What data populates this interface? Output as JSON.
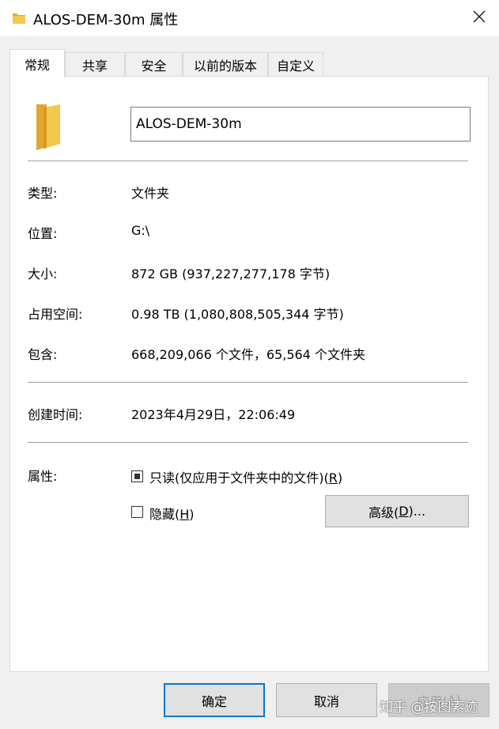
{
  "window": {
    "title": "ALOS-DEM-30m 属性",
    "close_icon": "close-icon"
  },
  "tabs": [
    {
      "label": "常规",
      "active": true
    },
    {
      "label": "共享",
      "active": false
    },
    {
      "label": "安全",
      "active": false
    },
    {
      "label": "以前的版本",
      "active": false
    },
    {
      "label": "自定义",
      "active": false
    }
  ],
  "general": {
    "folder_icon": "folder-icon",
    "name_value": "ALOS-DEM-30m",
    "type_label": "类型:",
    "type_value": "文件夹",
    "location_label": "位置:",
    "location_value": "G:\\",
    "size_label": "大小:",
    "size_value": "872 GB (937,227,277,178 字节)",
    "disk_size_label": "占用空间:",
    "disk_size_value": "0.98 TB (1,080,808,505,344 字节)",
    "contains_label": "包含:",
    "contains_value": "668,209,066 个文件，65,564 个文件夹",
    "created_label": "创建时间:",
    "created_value": "2023年4月29日，22:06:49",
    "attributes_label": "属性:",
    "readonly_text": "只读(仅应用于文件夹中的文件)(",
    "readonly_key": "R",
    "readonly_close": ")",
    "readonly_state": "indeterminate",
    "hidden_text": "隐藏(",
    "hidden_key": "H",
    "hidden_close": ")",
    "hidden_checked": false,
    "advanced_text": "高级(",
    "advanced_key": "D",
    "advanced_close": ")..."
  },
  "footer": {
    "ok_label": "确定",
    "cancel_label": "取消",
    "apply_text": "应用(",
    "apply_key": "A",
    "apply_close": ")"
  },
  "watermark": "知乎 @按图索迹",
  "colors": {
    "folder_yellow": "#f2c94c",
    "folder_dark": "#e0a82e",
    "primary_border": "#0078d7"
  }
}
